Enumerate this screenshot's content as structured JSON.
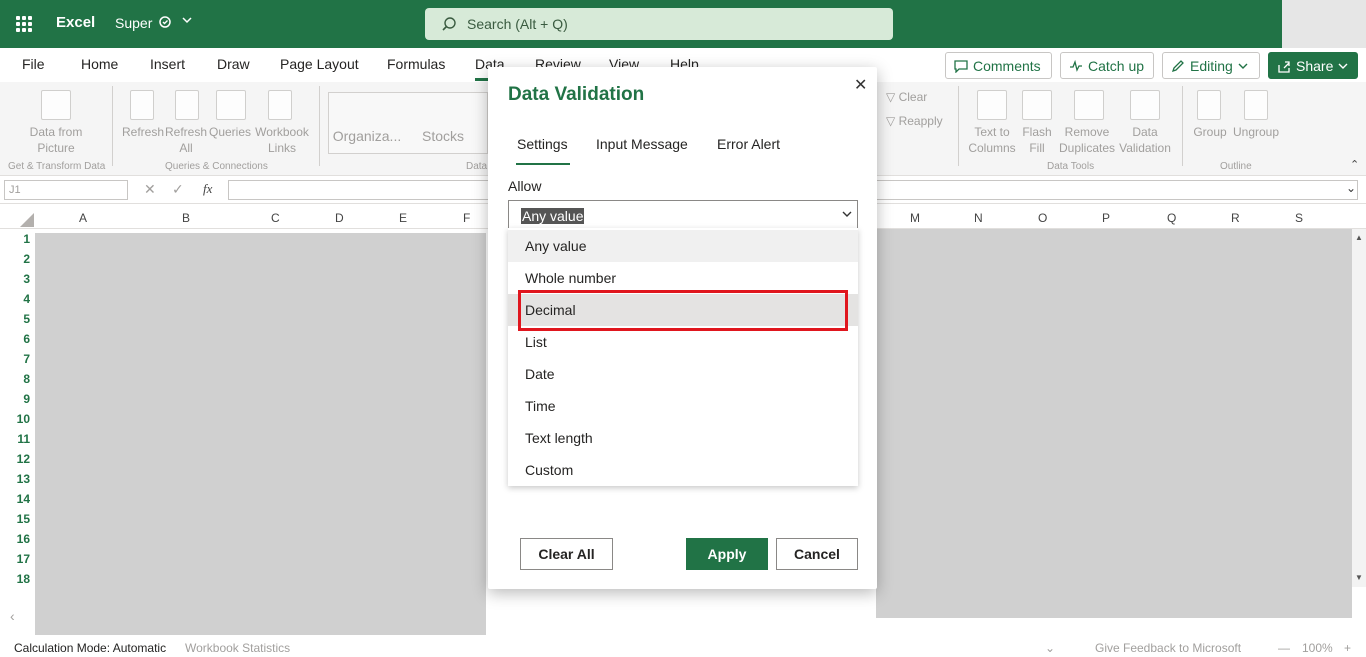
{
  "titlebar": {
    "app_name": "Excel",
    "file_name": "Super",
    "search_placeholder": "Search (Alt + Q)"
  },
  "tabs": [
    "File",
    "Home",
    "Insert",
    "Draw",
    "Page Layout",
    "Formulas",
    "Data",
    "Review",
    "View",
    "Help"
  ],
  "active_tab": "Data",
  "top_buttons": {
    "comments": "Comments",
    "catch_up": "Catch up",
    "editing": "Editing",
    "share": "Share"
  },
  "ribbon": {
    "data_from_picture": "Data from Picture",
    "refresh": "Refresh",
    "refresh_all": "Refresh All",
    "queries": "Queries",
    "workbook_links": "Workbook Links",
    "organiza": "Organiza...",
    "stocks": "Stocks",
    "clear": "Clear",
    "reapply": "Reapply",
    "text_to_columns": "Text to Columns",
    "flash_fill": "Flash Fill",
    "remove_duplicates": "Remove Duplicates",
    "data_validation": "Data Validation",
    "group": "Group",
    "ungroup": "Ungroup",
    "grp_get_transform": "Get & Transform Data",
    "grp_queries": "Queries & Connections",
    "grp_data_types": "Data",
    "grp_data_tools": "Data Tools",
    "grp_outline": "Outline"
  },
  "formula_bar": {
    "name_box": "J1",
    "fx": "fx"
  },
  "columns": [
    "A",
    "B",
    "C",
    "D",
    "E",
    "F",
    "M",
    "N",
    "O",
    "P",
    "Q",
    "R",
    "S"
  ],
  "rows": [
    "1",
    "2",
    "3",
    "4",
    "5",
    "6",
    "7",
    "8",
    "9",
    "10",
    "11",
    "12",
    "13",
    "14",
    "15",
    "16",
    "17",
    "18"
  ],
  "status": {
    "calc_mode": "Calculation Mode: Automatic",
    "workbook_stats": "Workbook Statistics",
    "feedback": "Give Feedback to Microsoft",
    "zoom": "100%"
  },
  "dialog": {
    "title": "Data Validation",
    "tabs": [
      "Settings",
      "Input Message",
      "Error Alert"
    ],
    "active_tab": "Settings",
    "allow_label": "Allow",
    "allow_value": "Any value",
    "options": [
      "Any value",
      "Whole number",
      "Decimal",
      "List",
      "Date",
      "Time",
      "Text length",
      "Custom"
    ],
    "highlighted_option": "Decimal",
    "buttons": {
      "clear_all": "Clear All",
      "apply": "Apply",
      "cancel": "Cancel"
    }
  },
  "colors": {
    "brand": "#217346",
    "highlight_border": "#e0161e"
  }
}
